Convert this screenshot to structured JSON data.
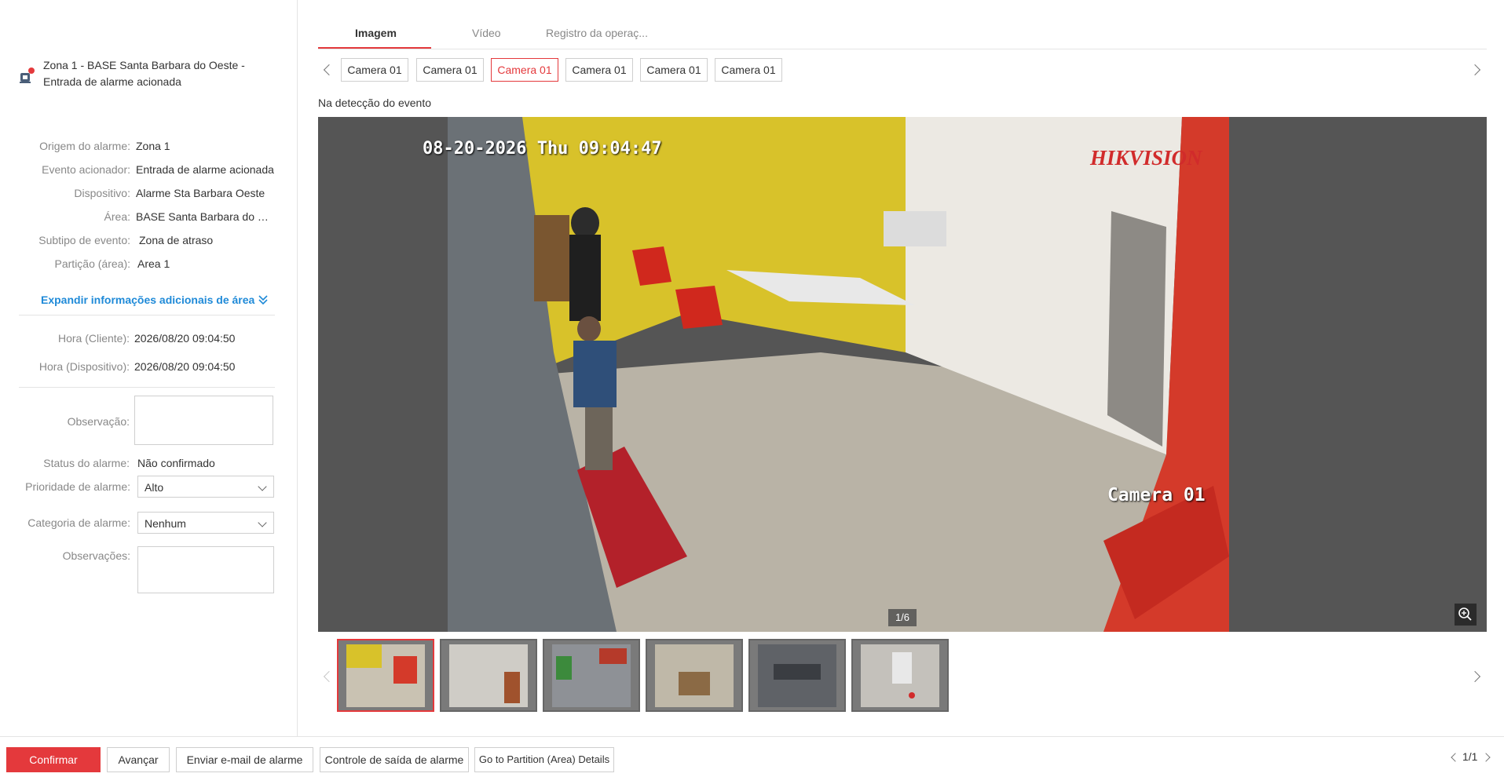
{
  "alarm": {
    "title": "Zona 1 - BASE Santa Barbara do Oeste - Entrada de alarme acionada",
    "icon": "alarm-siren-icon"
  },
  "details": [
    {
      "label": "Origem do alarme:",
      "value": "Zona 1"
    },
    {
      "label": "Evento acionador:",
      "value": "Entrada de alarme acionada"
    },
    {
      "label": "Dispositivo:",
      "value": "Alarme Sta Barbara Oeste"
    },
    {
      "label": "Área:",
      "value": "BASE Santa Barbara do Oeste"
    },
    {
      "label": "Subtipo de evento:",
      "value": "Zona de atraso"
    },
    {
      "label": "Partição (área):",
      "value": "Area 1"
    }
  ],
  "expand_link": "Expandir informações adicionais de área",
  "times": [
    {
      "label": "Hora (Cliente):",
      "value": "2026/08/20 09:04:50"
    },
    {
      "label": "Hora (Dispositivo):",
      "value": "2026/08/20 09:04:50"
    }
  ],
  "form": {
    "observacao_label": "Observação:",
    "observacao_value": "",
    "status_label": "Status do alarme:",
    "status_value": "Não confirmado",
    "priority_label": "Prioridade de alarme:",
    "priority_value": "Alto",
    "category_label": "Categoria de alarme:",
    "category_value": "Nenhum",
    "observacoes_label": "Observações:",
    "observacoes_value": ""
  },
  "tabs": [
    "Imagem",
    "Vídeo",
    "Registro da operaç..."
  ],
  "active_tab": 0,
  "cameras": [
    "Camera 01",
    "Camera 01",
    "Camera 01",
    "Camera 01",
    "Camera 01",
    "Camera 01"
  ],
  "active_camera": 2,
  "event_caption": "Na detecção do evento",
  "image": {
    "osd_timestamp": "08-20-2026 Thu 09:04:47",
    "osd_brand": "HIKVISION",
    "osd_camera": "Camera 01",
    "counter": "1/6"
  },
  "thumbnails_count": 6,
  "active_thumbnail": 0,
  "footer": {
    "confirm": "Confirmar",
    "advance": "Avançar",
    "email": "Enviar e-mail de alarme",
    "output": "Controle de saída de alarme",
    "partition": "Go to Partition (Area) Details",
    "pager": "1/1"
  },
  "colors": {
    "accent": "#e4393c",
    "link": "#1f8ad8"
  }
}
